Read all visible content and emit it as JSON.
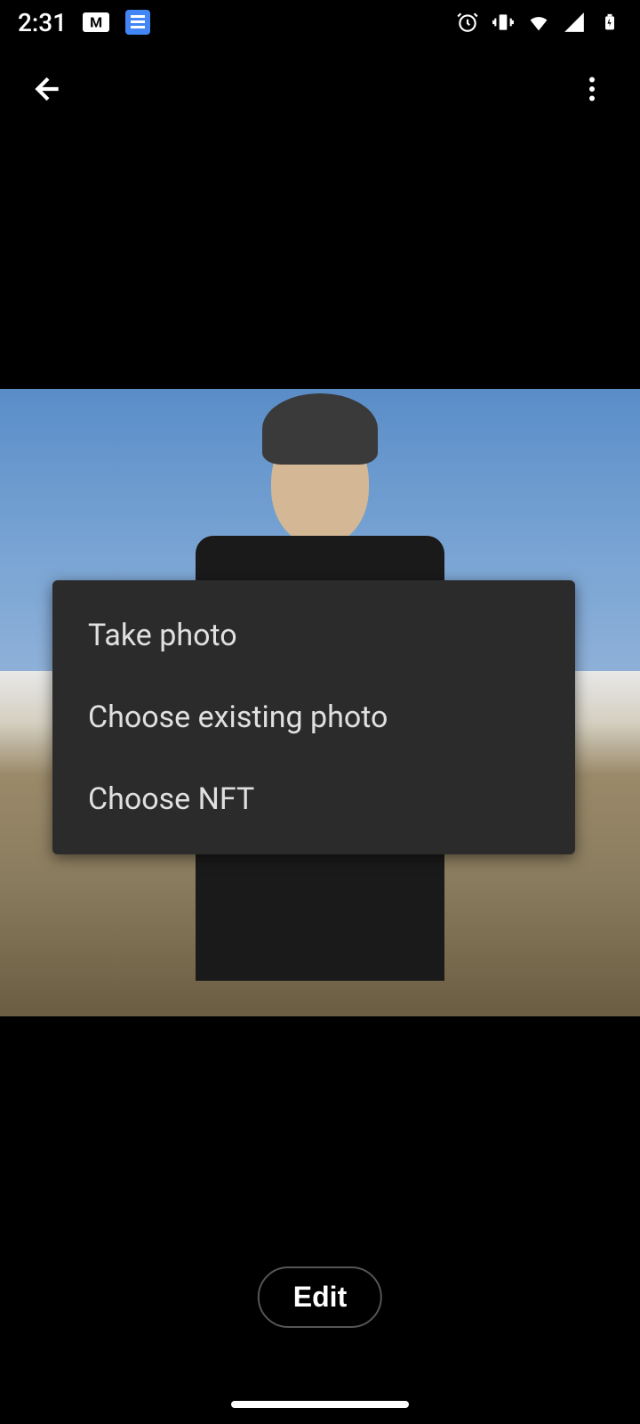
{
  "status_bar": {
    "time": "2:31"
  },
  "menu": {
    "items": [
      {
        "label": "Take photo"
      },
      {
        "label": "Choose existing photo"
      },
      {
        "label": "Choose NFT"
      }
    ]
  },
  "actions": {
    "edit_label": "Edit"
  }
}
